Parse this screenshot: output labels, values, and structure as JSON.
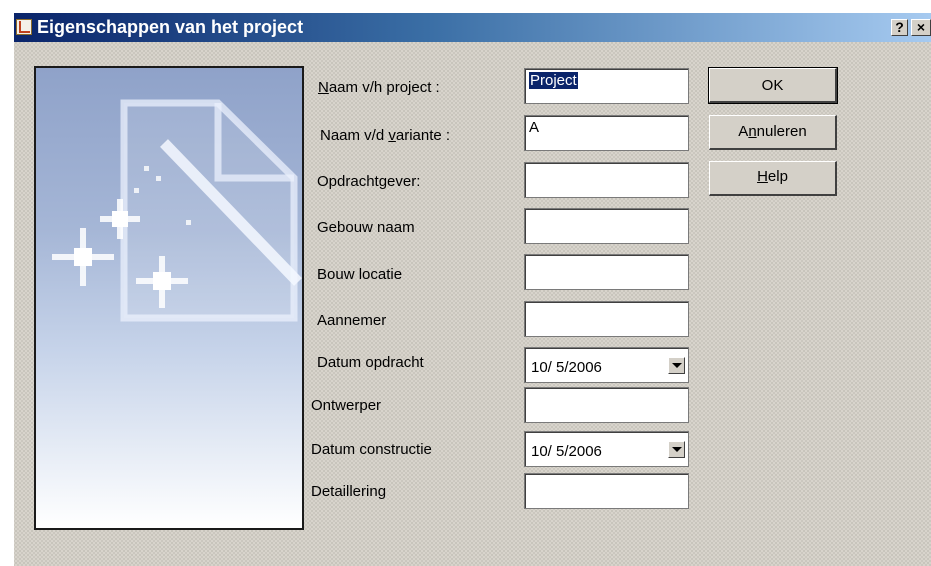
{
  "window": {
    "title": "Eigenschappen van het project",
    "help_glyph": "?",
    "close_glyph": "×",
    "icon": "app-icon"
  },
  "fields": {
    "project_name": {
      "label_prefix": "",
      "label_underlined": "N",
      "label_rest": "aam v/h project :",
      "value": "Project"
    },
    "variant_name": {
      "label_prefix": "Naam v/d ",
      "label_underlined": "v",
      "label_rest": "ariante :",
      "value": "A"
    },
    "client": {
      "label": "Opdrachtgever:",
      "value": ""
    },
    "building_name": {
      "label": "Gebouw naam",
      "value": ""
    },
    "building_location": {
      "label": "Bouw locatie",
      "value": ""
    },
    "contractor": {
      "label": "Aannemer",
      "value": ""
    },
    "order_date": {
      "label": "Datum opdracht",
      "value": "10/  5/2006"
    },
    "designer": {
      "label": "Ontwerper",
      "value": ""
    },
    "construction_date": {
      "label": "Datum constructie",
      "value": "10/  5/2006"
    },
    "detailing": {
      "label": "Detaillering",
      "value": ""
    }
  },
  "buttons": {
    "ok": "OK",
    "cancel_prefix": "A",
    "cancel_underlined": "n",
    "cancel_rest": "nuleren",
    "help_underlined": "H",
    "help_rest": "elp"
  },
  "colors": {
    "titlebar_start": "#0a246a",
    "titlebar_end": "#a6caf0",
    "dialog_bg": "#d8d4cc",
    "selection": "#0a246a"
  }
}
